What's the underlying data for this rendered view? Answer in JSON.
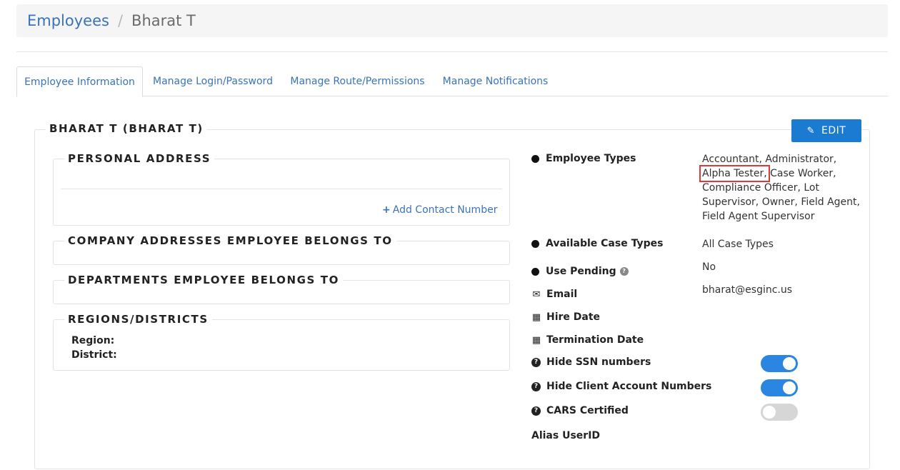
{
  "breadcrumb": {
    "parent": "Employees",
    "separator": "/",
    "current": "Bharat T"
  },
  "tabs": [
    {
      "label": "Employee Information",
      "active": true
    },
    {
      "label": "Manage Login/Password",
      "active": false
    },
    {
      "label": "Manage Route/Permissions",
      "active": false
    },
    {
      "label": "Manage Notifications",
      "active": false
    }
  ],
  "employee": {
    "heading": "BHARAT T (BHARAT T)",
    "edit_label": "EDIT",
    "edit_icon": "edit-icon"
  },
  "sections": {
    "personal_address": "PERSONAL ADDRESS",
    "add_contact": "Add Contact Number",
    "company_addresses": "COMPANY ADDRESSES EMPLOYEE BELONGS TO",
    "departments": "DEPARTMENTS EMPLOYEE BELONGS TO",
    "regions": "REGIONS/DISTRICTS",
    "region_label": "Region:",
    "district_label": "District:"
  },
  "details": {
    "employee_types_label": "Employee Types",
    "employee_types_before": "Accountant, Administrator,",
    "employee_types_highlight": "Alpha Tester,",
    "employee_types_after": "Case Worker, Compliance Officer, Lot Supervisor, Owner, Field Agent, Field Agent Supervisor",
    "case_types_label": "Available Case Types",
    "case_types_value": "All Case Types",
    "use_pending_label": "Use Pending",
    "use_pending_value": "No",
    "email_label": "Email",
    "email_value": "bharat@esginc.us",
    "hire_date_label": "Hire Date",
    "termination_date_label": "Termination Date",
    "hide_ssn_label": "Hide SSN numbers",
    "hide_ssn_on": true,
    "hide_client_label": "Hide Client Account Numbers",
    "hide_client_on": true,
    "cars_label": "CARS Certified",
    "cars_on": false,
    "alias_label": "Alias UserID"
  },
  "colors": {
    "accent": "#1a7bd1",
    "link": "#3a73b8",
    "toggle_on": "#2a86e0",
    "toggle_off": "#d6d6d6",
    "highlight": "#d93a3a"
  }
}
